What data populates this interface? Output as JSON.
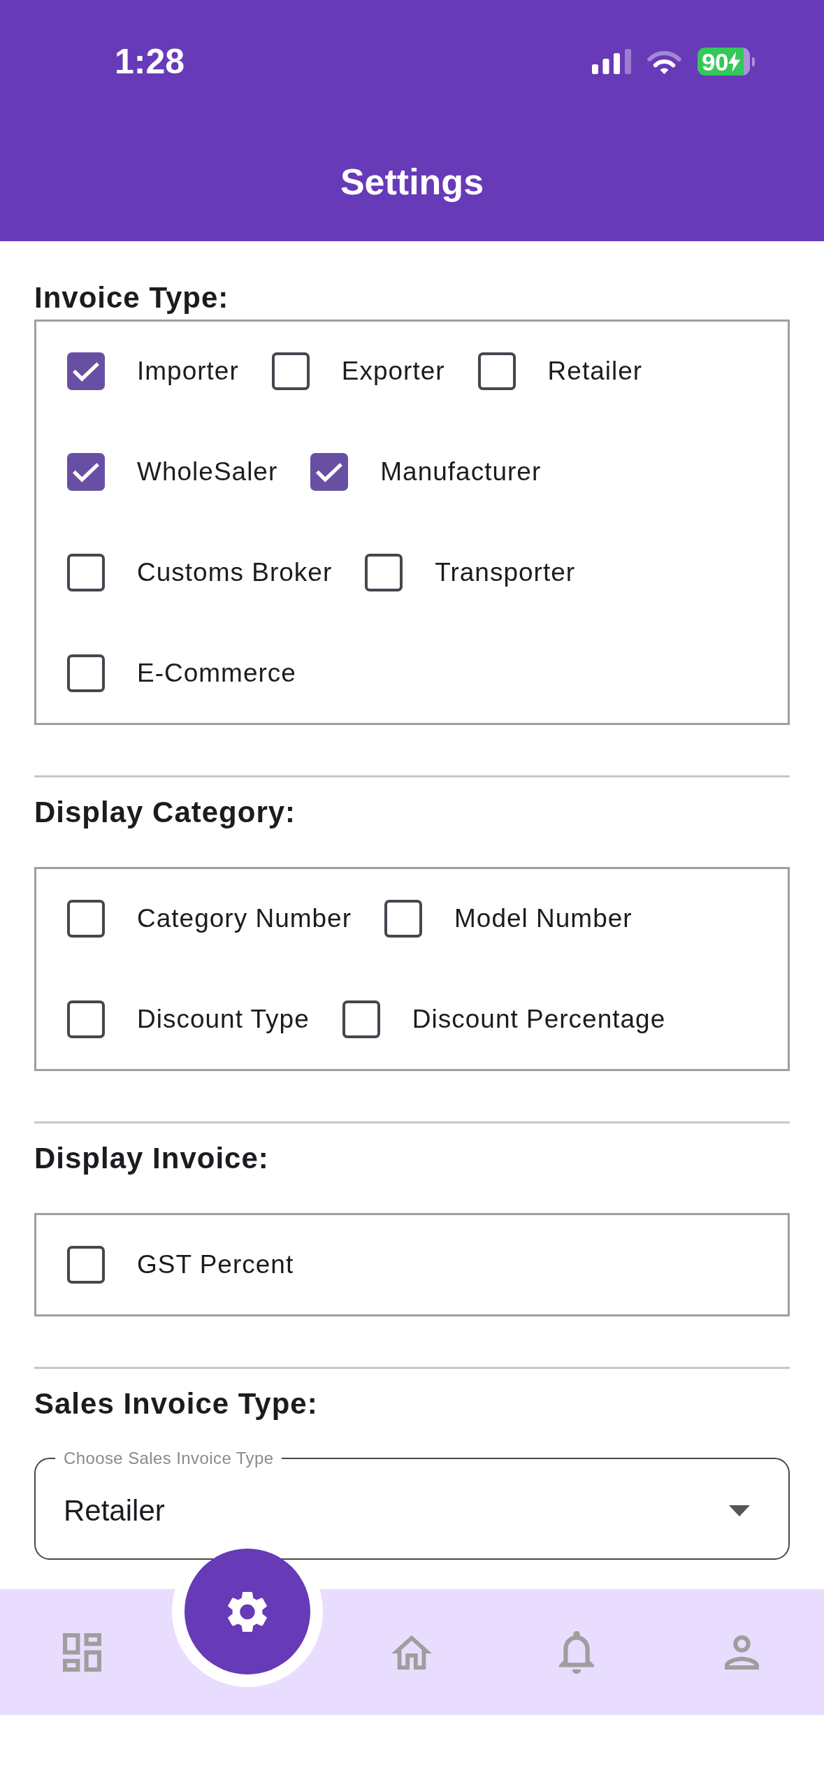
{
  "status_bar": {
    "time": "1:28",
    "battery": "90"
  },
  "app_bar": {
    "title": "Settings"
  },
  "sections": [
    {
      "kind": "checkbox_group",
      "heading": "Invoice Type:",
      "options": [
        {
          "label": "Importer",
          "checked": true
        },
        {
          "label": "Exporter",
          "checked": false
        },
        {
          "label": "Retailer",
          "checked": false
        },
        {
          "label": "WholeSaler",
          "checked": true
        },
        {
          "label": "Manufacturer",
          "checked": true
        },
        {
          "label": "Customs Broker",
          "checked": false
        },
        {
          "label": "Transporter",
          "checked": false
        },
        {
          "label": "E-Commerce",
          "checked": false
        }
      ]
    },
    {
      "kind": "checkbox_group",
      "heading": "Display Category:",
      "options": [
        {
          "label": "Category Number",
          "checked": false
        },
        {
          "label": "Model Number",
          "checked": false
        },
        {
          "label": "Discount Type",
          "checked": false
        },
        {
          "label": "Discount Percentage",
          "checked": false
        }
      ]
    },
    {
      "kind": "checkbox_group",
      "heading": "Display Invoice:",
      "options": [
        {
          "label": "GST Percent",
          "checked": false
        }
      ]
    },
    {
      "kind": "dropdown",
      "heading": "Sales Invoice Type:",
      "dropdown": {
        "label": "Choose Sales Invoice Type",
        "value": "Retailer"
      }
    }
  ],
  "bottom_nav": [
    {
      "selected": false
    },
    {
      "selected": true
    },
    {
      "selected": false
    },
    {
      "selected": false
    },
    {
      "selected": false
    }
  ]
}
